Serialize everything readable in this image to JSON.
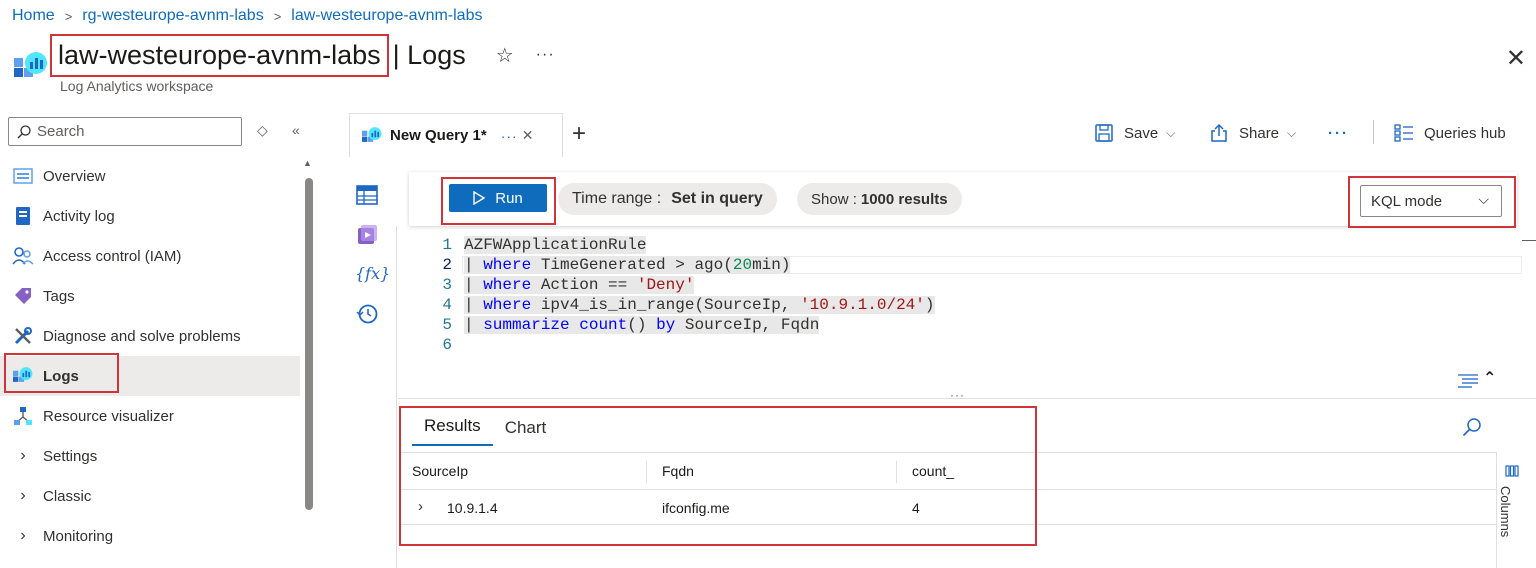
{
  "breadcrumb": [
    {
      "label": "Home"
    },
    {
      "label": "rg-westeurope-avnm-labs"
    },
    {
      "label": "law-westeurope-avnm-labs"
    }
  ],
  "header": {
    "resource_name": "law-westeurope-avnm-labs",
    "blade": "| Logs",
    "subtitle": "Log Analytics workspace",
    "star": "☆",
    "more": "···",
    "close": "✕"
  },
  "sidebar": {
    "search_placeholder": "Search",
    "items": [
      {
        "label": "Overview",
        "icon": "overview-icon"
      },
      {
        "label": "Activity log",
        "icon": "activity-log-icon"
      },
      {
        "label": "Access control (IAM)",
        "icon": "people-icon"
      },
      {
        "label": "Tags",
        "icon": "tag-icon"
      },
      {
        "label": "Diagnose and solve problems",
        "icon": "wrench-icon"
      },
      {
        "label": "Logs",
        "icon": "logs-icon",
        "active": true
      },
      {
        "label": "Resource visualizer",
        "icon": "visualizer-icon"
      },
      {
        "label": "Settings",
        "icon": "chevron-right-icon",
        "group": true
      },
      {
        "label": "Classic",
        "icon": "chevron-right-icon",
        "group": true
      },
      {
        "label": "Monitoring",
        "icon": "chevron-right-icon",
        "group": true
      }
    ]
  },
  "tabs": {
    "query_tab_label": "New Query 1*",
    "query_tab_more": "···",
    "query_tab_close": "✕",
    "add_tab": "+"
  },
  "toolbar": {
    "save": "Save",
    "share": "Share",
    "more": "···",
    "queries_hub": "Queries hub"
  },
  "querybar": {
    "run": "Run",
    "time_range_label": "Time range :",
    "time_range_value": "Set in query",
    "show_label": "Show :",
    "show_value": "1000 results",
    "mode": "KQL mode"
  },
  "editor": {
    "lines": [
      {
        "n": "1"
      },
      {
        "n": "2"
      },
      {
        "n": "3"
      },
      {
        "n": "4"
      },
      {
        "n": "5"
      },
      {
        "n": "6"
      }
    ]
  },
  "results": {
    "tabs": [
      "Results",
      "Chart"
    ],
    "columns": [
      "SourceIp",
      "Fqdn",
      "count_"
    ],
    "rows": [
      {
        "SourceIp": "10.9.1.4",
        "Fqdn": "ifconfig.me",
        "count_": "4"
      }
    ],
    "columns_panel": "Columns"
  },
  "colors": {
    "accent": "#0f6cbd",
    "highlight_border": "#d13438"
  }
}
